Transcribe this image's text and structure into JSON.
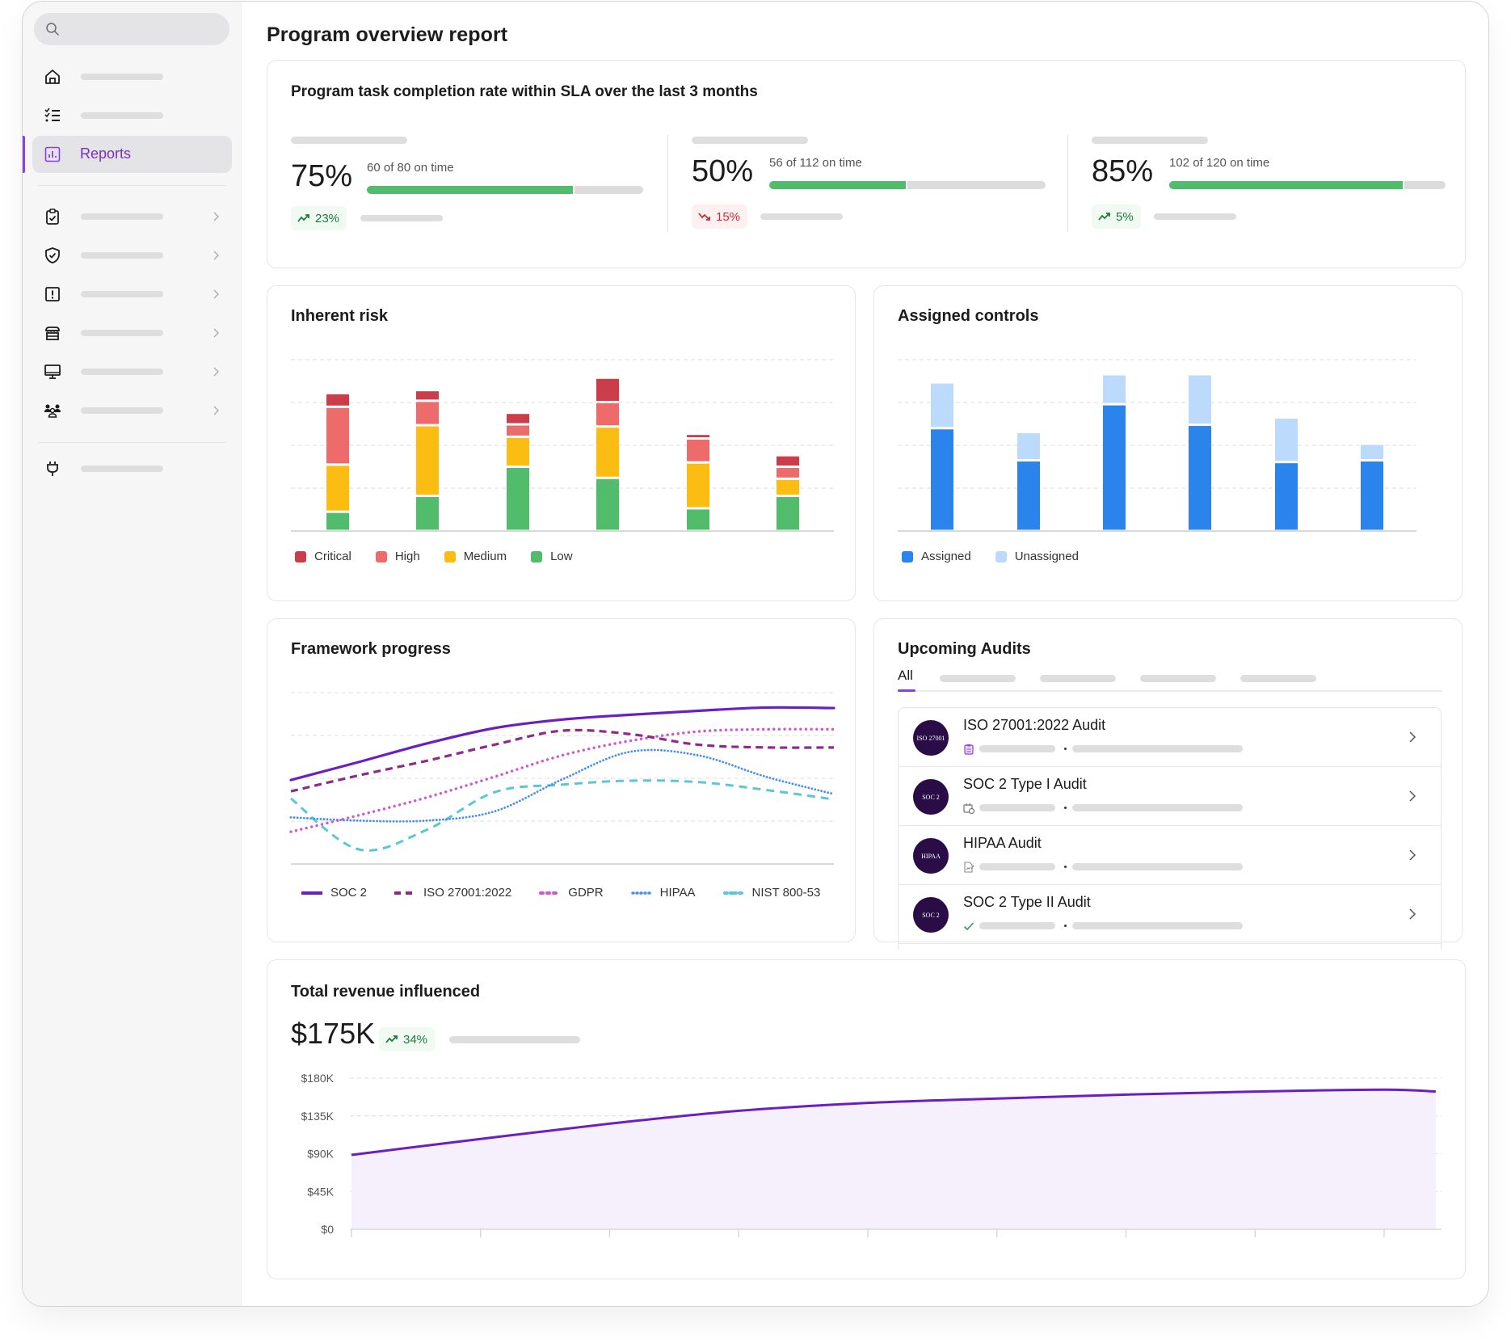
{
  "sidebar": {
    "search": {
      "placeholder": "",
      "icon": "search-icon"
    },
    "items": [
      {
        "icon": "home-icon",
        "label": "",
        "active": false,
        "has_chevron": false
      },
      {
        "icon": "checklist-icon",
        "label": "",
        "active": false,
        "has_chevron": false
      },
      {
        "icon": "bar-chart-icon",
        "label": "Reports",
        "active": true,
        "has_chevron": false
      },
      {
        "icon": "clipboard-check-icon",
        "label": "",
        "active": false,
        "has_chevron": true
      },
      {
        "icon": "shield-check-icon",
        "label": "",
        "active": false,
        "has_chevron": true
      },
      {
        "icon": "alert-square-icon",
        "label": "",
        "active": false,
        "has_chevron": true
      },
      {
        "icon": "store-icon",
        "label": "",
        "active": false,
        "has_chevron": true
      },
      {
        "icon": "monitor-icon",
        "label": "",
        "active": false,
        "has_chevron": true
      },
      {
        "icon": "people-icon",
        "label": "",
        "active": false,
        "has_chevron": true
      },
      {
        "icon": "plug-icon",
        "label": "",
        "active": false,
        "has_chevron": false
      }
    ]
  },
  "page": {
    "title": "Program overview report"
  },
  "sla": {
    "title": "Program task completion rate within SLA over the last 3 months",
    "kpis": [
      {
        "percent": "75%",
        "detail": "60 of 80 on time",
        "on_time": 60,
        "total": 80,
        "change": "23%",
        "trend": "up"
      },
      {
        "percent": "50%",
        "detail": "56 of 112 on time",
        "on_time": 56,
        "total": 112,
        "change": "15%",
        "trend": "down"
      },
      {
        "percent": "85%",
        "detail": "102 of 120 on time",
        "on_time": 102,
        "total": 120,
        "change": "5%",
        "trend": "up"
      }
    ]
  },
  "colors": {
    "accent": "#8a3fe0",
    "critical": "#cc3d4a",
    "high": "#ee6b6b",
    "medium": "#fbbd12",
    "low": "#52bc6d",
    "assigned": "#2b84ec",
    "unassigned": "#bcdafc",
    "soc2": "#6b1fc2",
    "iso": "#8e2a8a",
    "gdpr": "#d158c8",
    "hipaa": "#4a90e8",
    "nist": "#5cc6d6",
    "progress_fill": "#52bc6d",
    "trend_up": "#1e7a3a",
    "trend_down": "#c5303a"
  },
  "chart_data": [
    {
      "id": "inherent_risk",
      "type": "bar",
      "stacked": true,
      "title": "Inherent risk",
      "categories": [
        "",
        "",
        "",
        "",
        "",
        ""
      ],
      "ylim": [
        0,
        40
      ],
      "grid": true,
      "legend_position": "bottom-left",
      "series": [
        {
          "name": "Low",
          "values": [
            4.5,
            8.2,
            15,
            12.4,
            5.3,
            8.2
          ]
        },
        {
          "name": "Medium",
          "values": [
            11,
            16.5,
            7,
            12,
            10.7,
            4
          ]
        },
        {
          "name": "High",
          "values": [
            13.5,
            5.7,
            2.9,
            5.7,
            5.6,
            2.8
          ]
        },
        {
          "name": "Critical",
          "values": [
            3.2,
            2.5,
            2.7,
            5.7,
            1.1,
            2.7
          ]
        }
      ],
      "legend": [
        "Critical",
        "High",
        "Medium",
        "Low"
      ]
    },
    {
      "id": "assigned_controls",
      "type": "bar",
      "stacked": true,
      "title": "Assigned controls",
      "categories": [
        "",
        "",
        "",
        "",
        "",
        ""
      ],
      "ylim": [
        0,
        40
      ],
      "grid": true,
      "legend_position": "bottom-left",
      "series": [
        {
          "name": "Assigned",
          "values": [
            24,
            16.5,
            29.6,
            24.8,
            16.1,
            16.5
          ]
        },
        {
          "name": "Unassigned",
          "values": [
            10.7,
            6.6,
            7,
            11.8,
            10.4,
            3.9
          ]
        }
      ],
      "legend": [
        "Assigned",
        "Unassigned"
      ]
    },
    {
      "id": "framework_progress",
      "type": "line",
      "title": "Framework progress",
      "x": [
        0,
        1,
        2,
        3,
        4,
        5,
        6,
        7,
        8
      ],
      "ylim": [
        0,
        100
      ],
      "grid": true,
      "legend_position": "bottom",
      "series": [
        {
          "name": "SOC 2",
          "style": "solid",
          "values": [
            49,
            59.5,
            70.3,
            79.3,
            84.3,
            87.1,
            89.4,
            91.3,
            91
          ]
        },
        {
          "name": "ISO 27001:2022",
          "style": "dashed",
          "values": [
            42.4,
            51.7,
            60.2,
            69.6,
            77.8,
            75.8,
            69.6,
            68,
            68
          ]
        },
        {
          "name": "GDPR",
          "style": "dotted",
          "values": [
            18.8,
            28.4,
            38.8,
            50.9,
            63.4,
            71.9,
            77.3,
            78.6,
            78.6
          ]
        },
        {
          "name": "HIPAA",
          "style": "dotted-fine",
          "values": [
            27.2,
            25.3,
            25.3,
            30.7,
            49.4,
            65.5,
            63.4,
            50.9,
            40.8
          ]
        },
        {
          "name": "NIST 800-53",
          "style": "dash-dot",
          "values": [
            38.2,
            8.5,
            19.9,
            41.9,
            46.3,
            48.6,
            47.8,
            43.2,
            37.7
          ]
        }
      ]
    },
    {
      "id": "total_revenue",
      "type": "area",
      "title": "Total revenue influenced",
      "x": [
        0,
        1,
        2,
        3,
        4,
        5,
        6,
        7,
        8,
        8.4
      ],
      "values": [
        88.6,
        107.6,
        125.8,
        141.1,
        150.5,
        155.7,
        160.4,
        164,
        166.3,
        164
      ],
      "ylabel": "",
      "xlabel": "",
      "ylim": [
        0,
        180
      ],
      "yticks": [
        "$0",
        "$45K",
        "$90K",
        "$135K",
        "$180K"
      ],
      "ytick_values": [
        0,
        45,
        90,
        135,
        180
      ],
      "grid": true
    }
  ],
  "inherent_risk": {
    "title": "Inherent risk",
    "legend": [
      "Critical",
      "High",
      "Medium",
      "Low"
    ]
  },
  "assigned_controls": {
    "title": "Assigned controls",
    "legend": [
      "Assigned",
      "Unassigned"
    ]
  },
  "framework": {
    "title": "Framework progress",
    "legend": [
      "SOC 2",
      "ISO 27001:2022",
      "GDPR",
      "HIPAA",
      "NIST 800-53"
    ]
  },
  "audits": {
    "title": "Upcoming Audits",
    "tabs": [
      {
        "label": "All",
        "active": true
      },
      {
        "label": ""
      },
      {
        "label": ""
      },
      {
        "label": ""
      },
      {
        "label": ""
      }
    ],
    "items": [
      {
        "name": "ISO 27001:2022 Audit",
        "logo_text": "ISO 27001",
        "status_icon": "clipboard-list-icon"
      },
      {
        "name": "SOC 2 Type I Audit",
        "logo_text": "SOC 2",
        "status_icon": "calendar-clock-icon"
      },
      {
        "name": "HIPAA Audit",
        "logo_text": "HIPAA",
        "status_icon": "document-sign-icon"
      },
      {
        "name": "SOC 2 Type II Audit",
        "logo_text": "SOC 2",
        "status_icon": "check-icon"
      }
    ]
  },
  "revenue": {
    "title": "Total revenue influenced",
    "total": "$175K",
    "change": "34%",
    "trend": "up"
  }
}
